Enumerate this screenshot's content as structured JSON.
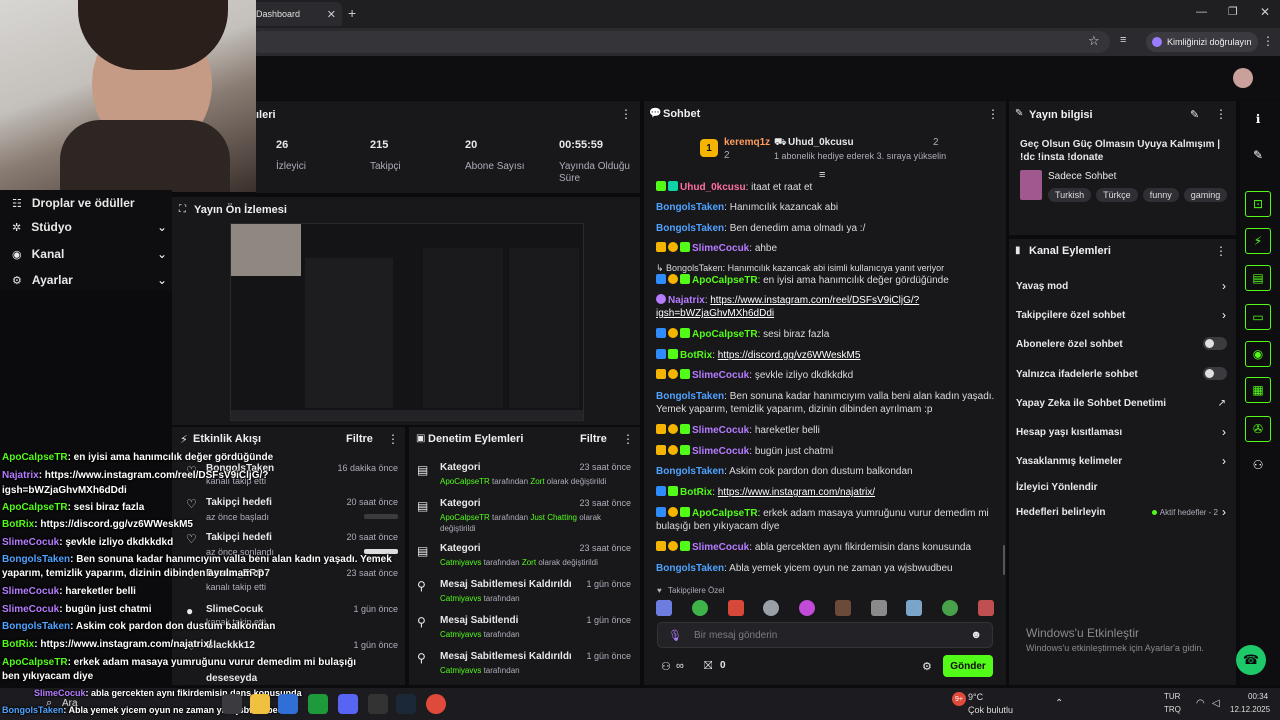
{
  "browser": {
    "tab_title": "Dashboard",
    "profile_label": "Kimliğinizi doğrulayın"
  },
  "sidebar": {
    "items": [
      {
        "label": "Droplar ve ödüller",
        "chevron": ""
      },
      {
        "label": "Stüdyo",
        "chevron": "⌄"
      },
      {
        "label": "Kanal",
        "chevron": "⌄"
      },
      {
        "label": "Ayarlar",
        "chevron": "⌄"
      }
    ]
  },
  "stats_panel": {
    "title_fragment": "ıleri",
    "stats": [
      {
        "value": "26",
        "label": "İzleyici"
      },
      {
        "value": "215",
        "label": "Takipçi"
      },
      {
        "value": "20",
        "label": "Abone Sayısı"
      },
      {
        "value": "00:55:59",
        "label": "Yayında Olduğu Süre"
      }
    ]
  },
  "preview": {
    "title": "Yayın Ön İzlemesi"
  },
  "activity": {
    "title": "Etkinlik Akışı",
    "filter": "Filtre",
    "items": [
      {
        "title": "BongolsTaken",
        "sub": "kanalı takip etti",
        "time": "16 dakika önce",
        "progress": null
      },
      {
        "title": "Takipçi hedefi",
        "sub": "az önce başladı",
        "time": "20 saat önce",
        "progress": 0
      },
      {
        "title": "Takipçi hedefi",
        "sub": "az önce sonlandı",
        "time": "20 saat önce",
        "progress": 1
      },
      {
        "title": "Bosun_ERO7",
        "sub": "kanalı takip etti",
        "time": "23 saat önce",
        "progress": null
      },
      {
        "title": "SlimeCocuk",
        "sub": "kanalı takip etti",
        "time": "1 gün önce",
        "progress": null
      },
      {
        "title": "Blackkk12",
        "sub": "",
        "time": "1 gün önce",
        "progress": null
      },
      {
        "title": "deseseyda",
        "sub": "",
        "time": "",
        "progress": null
      }
    ]
  },
  "moderation": {
    "title": "Denetim Eylemleri",
    "filter": "Filtre",
    "items": [
      {
        "title": "Kategori",
        "user": "ApoCalpseTR",
        "mid": "tarafından",
        "target": "Zort",
        "tail": "olarak değiştirildi",
        "time": "23 saat önce",
        "icon": "tv-icon"
      },
      {
        "title": "Kategori",
        "user": "ApoCalpseTR",
        "mid": "tarafından",
        "target": "Just Chatting",
        "tail": "olarak değiştirildi",
        "time": "23 saat önce",
        "icon": "tv-icon"
      },
      {
        "title": "Kategori",
        "user": "Catmiyavvs",
        "mid": "tarafından",
        "target": "Zort",
        "tail": "olarak değiştirildi",
        "time": "23 saat önce",
        "icon": "tv-icon"
      },
      {
        "title": "Mesaj Sabitlemesi Kaldırıldı",
        "user": "Catmiyavvs",
        "mid": "tarafından",
        "target": "",
        "tail": "",
        "time": "1 gün önce",
        "icon": "unpin-icon"
      },
      {
        "title": "Mesaj Sabitlendi",
        "user": "Catmiyavvs",
        "mid": "tarafından",
        "target": "",
        "tail": "",
        "time": "1 gün önce",
        "icon": "pin-icon"
      },
      {
        "title": "Mesaj Sabitlemesi Kaldırıldı",
        "user": "Catmiyavvs",
        "mid": "tarafından",
        "target": "",
        "tail": "",
        "time": "1 gün önce",
        "icon": "unpin-icon"
      }
    ]
  },
  "chat": {
    "title": "Sohbet",
    "leaderboard": [
      {
        "name": "keremq1z",
        "count": "2"
      },
      {
        "name": "Uhud_0kcusu",
        "count": "2"
      }
    ],
    "gift_note": "1 abonelik hediye ederek 3. sıraya yükselin",
    "pinned_user": "Uhud_0kcusu",
    "pinned_text": "itaat et raat et",
    "messages": [
      {
        "user": "BongolsTaken",
        "text": "Hanımcılık kazancak abi"
      },
      {
        "user": "BongolsTaken",
        "text": "Ben denedim ama olmadı ya :/"
      },
      {
        "user": "SlimeCocuk",
        "text": "ahbe"
      },
      {
        "reply": "BongolsTaken: Hanımcılık kazancak abi isimli kullanıcıya yanıt veriyor"
      },
      {
        "user": "ApoCalpseTR",
        "text": "en iyisi ama hanımcılık değer gördüğünde"
      },
      {
        "user": "Najatrix",
        "text": "https://www.instagram.com/reel/DSFsV9iCljG/?igsh=bWZjaGhvMXh6dDdi"
      },
      {
        "user": "ApoCalpseTR",
        "text": "sesi biraz fazla"
      },
      {
        "user": "BotRix",
        "text": "https://discord.gg/vz6WWeskM5"
      },
      {
        "user": "SlimeCocuk",
        "text": "şevkle izliyo dkdkkdkd"
      },
      {
        "user": "BongolsTaken",
        "text": "Ben sonuna kadar hanımcıyım valla beni alan kadın yaşadı. Yemek yaparım, temizlik yaparım, dizinin dibinden ayrılmam :p"
      },
      {
        "user": "SlimeCocuk",
        "text": "hareketler belli"
      },
      {
        "user": "SlimeCocuk",
        "text": "bugün just chatmi"
      },
      {
        "user": "BongolsTaken",
        "text": "Askim cok pardon don dustum balkondan"
      },
      {
        "user": "BotRix",
        "text": "https://www.instagram.com/najatrix/"
      },
      {
        "user": "ApoCalpseTR",
        "text": "erkek adam masaya yumruğunu vurur demedim mi bulaşığı ben yıkıyacam diye"
      },
      {
        "user": "SlimeCocuk",
        "text": "abla gercekten aynı fikirdemisin dans konusunda"
      },
      {
        "user": "BongolsTaken",
        "text": "Abla yemek yicem oyun ne zaman ya wjsbwudbeu"
      }
    ],
    "followers_only_label": "Takipçilere Özel",
    "input_placeholder": "Bir mesaj gönderin",
    "points": "0",
    "send_label": "Gönder"
  },
  "stream_info": {
    "title": "Yayın bilgisi",
    "stream_title": "Geç Olsun Güç Olmasın Uyuya Kalmışım | !dc !insta !donate",
    "category": "Sadece Sohbet",
    "tags": [
      "Turkish",
      "Türkçe",
      "funny",
      "gaming"
    ]
  },
  "channel_actions": {
    "title": "Kanal Eylemleri",
    "items": [
      {
        "label": "Yavaş mod",
        "control": "chevron"
      },
      {
        "label": "Takipçilere özel sohbet",
        "control": "chevron"
      },
      {
        "label": "Abonelere özel sohbet",
        "control": "toggle"
      },
      {
        "label": "Yalnızca ifadelerle sohbet",
        "control": "toggle"
      },
      {
        "label": "Yapay Zeka ile Sohbet Denetimi",
        "control": "external"
      },
      {
        "label": "Hesap yaşı kısıtlaması",
        "control": "chevron"
      },
      {
        "label": "Yasaklanmış kelimeler",
        "control": "chevron"
      },
      {
        "label": "İzleyici Yönlendir",
        "control": "none"
      },
      {
        "label": "Hedefleri belirleyin",
        "control": "goals"
      }
    ],
    "goals_status": "Aktif hedefler - 2"
  },
  "windows_activation": {
    "title": "Windows'u Etkinleştir",
    "sub": "Windows'u etkinleştirmek için Ayarlar'a gidin."
  },
  "overlay_chat": [
    {
      "user": "ApoCalpseTR",
      "text": ": en iyisi ama hanımcılık değer gördüğünde"
    },
    {
      "user": "Najatrix",
      "text": ": https://www.instagram.com/reel/DSFsV9iCljG/?"
    },
    {
      "user": "",
      "text": "igsh=bWZjaGhvMXh6dDdi"
    },
    {
      "user": "ApoCalpseTR",
      "text": ": sesi biraz fazla"
    },
    {
      "user": "BotRix",
      "text": ": https://discord.gg/vz6WWeskM5"
    },
    {
      "user": "SlimeCocuk",
      "text": ": şevkle izliyo dkdkkdkd"
    },
    {
      "user": "BongolsTaken",
      "text": ": Ben sonuna kadar hanımcıyım valla beni alan kadın yaşadı. Yemek"
    },
    {
      "user": "",
      "text": "yaparım, temizlik yaparım, dizinin dibinden ayrılmam :p"
    },
    {
      "user": "SlimeCocuk",
      "text": ": hareketler belli"
    },
    {
      "user": "SlimeCocuk",
      "text": ": bugün just chatmi"
    },
    {
      "user": "BongolsTaken",
      "text": ": Askim cok pardon don dustum balkondan"
    },
    {
      "user": "BotRix",
      "text": ": https://www.instagram.com/najatrix/"
    },
    {
      "user": "ApoCalpseTR",
      "text": ": erkek adam masaya yumruğunu vurur demedim mi bulaşığı"
    },
    {
      "user": "",
      "text": "ben yıkıyacam diye"
    },
    {
      "user": "SlimeCocuk",
      "text": ": abla gercekten aynı fikirdemisin dans konusunda"
    },
    {
      "user": "BongolsTaken",
      "text": ": Abla yemek yicem oyun ne zaman ya wjsbwudbeu"
    }
  ],
  "taskbar": {
    "search": "Ara",
    "weather_temp": "9°C",
    "weather_desc": "Çok bulutlu",
    "lang": "TUR",
    "lang2": "TRQ",
    "time": "00:34",
    "date": "12.12.2025",
    "notif_count": "9+"
  },
  "colors": {
    "accent": "#53fc18",
    "bg": "#0b0b0d",
    "panel": "#18181b"
  }
}
